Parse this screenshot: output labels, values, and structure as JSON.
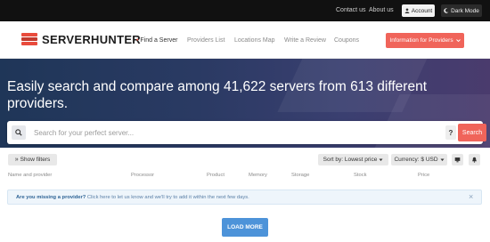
{
  "topbar": {
    "contact": "Contact us",
    "about": "About us",
    "account": "Account",
    "dark_mode": "Dark Mode"
  },
  "nav": {
    "logo": "SERVERHUNTER",
    "items": [
      {
        "label": "Find a Server",
        "active": true
      },
      {
        "label": "Providers List"
      },
      {
        "label": "Locations Map"
      },
      {
        "label": "Write a Review"
      },
      {
        "label": "Coupons"
      }
    ],
    "info_button": "Information for Providers"
  },
  "hero": {
    "title": "Easily search and compare among 41,622 servers from 613 different providers."
  },
  "search": {
    "placeholder": "Search for your perfect server...",
    "help": "?",
    "button": "Search"
  },
  "toolbar": {
    "show_filters": "Show filters",
    "sort": "Sort by: Lowest price",
    "currency": "Currency: $ USD"
  },
  "table": {
    "headers": [
      "Name and provider",
      "Processor",
      "Product",
      "Memory",
      "Storage",
      "Stock",
      "Price"
    ]
  },
  "notice": {
    "question": "Are you missing a provider?",
    "text": "Click here to let us know and we'll try to add it within the next few days."
  },
  "load_more": "LOAD MORE",
  "colors": {
    "accent": "#f0645a",
    "logo_red": "#e94b3c",
    "load_blue": "#4d93d9",
    "topbar": "#111111"
  }
}
